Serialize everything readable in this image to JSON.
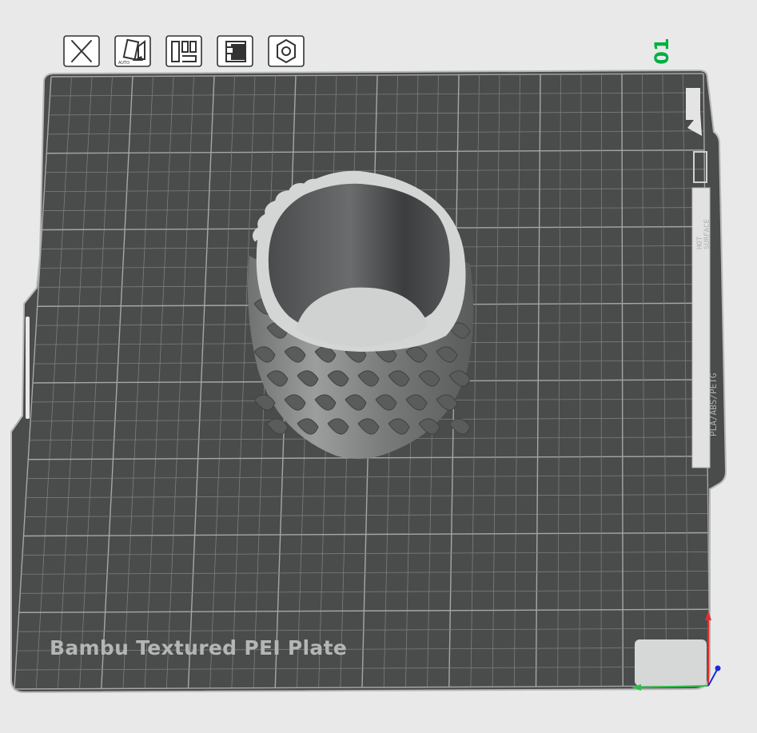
{
  "toolbar": {
    "buttons": [
      {
        "name": "delete-plate-button",
        "icon": "close-icon"
      },
      {
        "name": "auto-orient-button",
        "icon": "auto-orient-icon",
        "badge": "AUTO"
      },
      {
        "name": "arrange-button",
        "icon": "arrange-icon"
      },
      {
        "name": "lock-plate-button",
        "icon": "lock-icon"
      },
      {
        "name": "plate-settings-button",
        "icon": "hexagon-nut-icon"
      }
    ]
  },
  "plate": {
    "number": "01",
    "label": "Bambu Textured PEI Plate",
    "warning_line1": "HOT",
    "warning_line2": "SURFACE",
    "filament_text": "PLA/ABS/PETG"
  },
  "colors": {
    "background": "#e9e9ea",
    "plate_fill": "#4a4b4b",
    "grid_line": "#8b8d8d",
    "accent_green": "#00ae42",
    "model_gray": "#8a8a8a",
    "axis_x": "#e03030",
    "axis_y": "#2bc047",
    "axis_z": "#1a2bd6"
  }
}
